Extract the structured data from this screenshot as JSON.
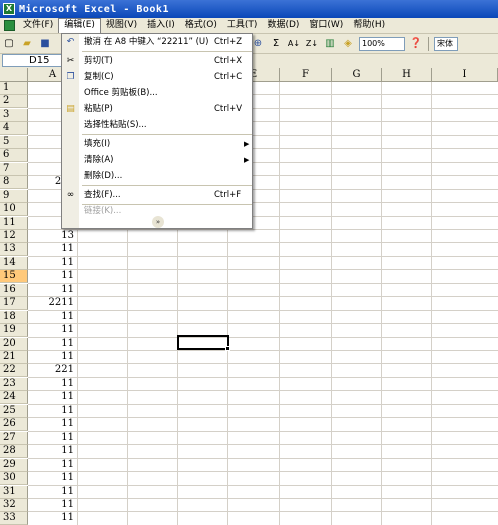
{
  "window": {
    "title": "Microsoft Excel - Book1"
  },
  "menubar": {
    "items": [
      {
        "label": "文件(F)"
      },
      {
        "label": "编辑(E)"
      },
      {
        "label": "视图(V)"
      },
      {
        "label": "插入(I)"
      },
      {
        "label": "格式(O)"
      },
      {
        "label": "工具(T)"
      },
      {
        "label": "数据(D)"
      },
      {
        "label": "窗口(W)"
      },
      {
        "label": "帮助(H)"
      }
    ]
  },
  "toolbar": {
    "zoom": "100%",
    "font": "宋体"
  },
  "formula_bar": {
    "name_box": "D15"
  },
  "edit_menu": {
    "items": [
      {
        "label": "撤消 在 A8 中键入 “22211” (U)",
        "shortcut": "Ctrl+Z",
        "icon": "undo-icon"
      },
      {
        "label": "剪切(T)",
        "shortcut": "Ctrl+X",
        "icon": "scissors-icon"
      },
      {
        "label": "复制(C)",
        "shortcut": "Ctrl+C",
        "icon": "copy-icon"
      },
      {
        "label": "Office 剪贴板(B)...",
        "shortcut": "",
        "icon": "clipboard-icon"
      },
      {
        "label": "粘贴(P)",
        "shortcut": "Ctrl+V",
        "icon": "paste-icon"
      },
      {
        "label": "选择性粘贴(S)...",
        "shortcut": "",
        "icon": ""
      },
      {
        "label": "填充(I)",
        "shortcut": "",
        "icon": ""
      },
      {
        "label": "清除(A)",
        "shortcut": "",
        "icon": ""
      },
      {
        "label": "删除(D)...",
        "shortcut": "",
        "icon": ""
      },
      {
        "label": "查找(F)...",
        "shortcut": "Ctrl+F",
        "icon": "binoculars-icon"
      },
      {
        "label": "链接(K)...",
        "shortcut": "",
        "icon": ""
      }
    ]
  },
  "sheet": {
    "columns": [
      "A",
      "B",
      "C",
      "D",
      "E",
      "F",
      "G",
      "H",
      "I"
    ],
    "rows": [
      "1",
      "2",
      "3",
      "4",
      "5",
      "6",
      "7",
      "8",
      "9",
      "10",
      "11",
      "12",
      "13",
      "14",
      "15",
      "16",
      "17",
      "18",
      "19",
      "20",
      "21",
      "22",
      "23",
      "24",
      "25",
      "26",
      "27",
      "28",
      "29",
      "30",
      "31",
      "32",
      "33"
    ],
    "column_a_values": [
      "",
      "",
      "",
      "",
      "",
      "",
      "",
      "222",
      "",
      "",
      "",
      "13",
      "11",
      "11",
      "11",
      "11",
      "2211",
      "11",
      "11",
      "11",
      "11",
      "221",
      "11",
      "11",
      "11",
      "11",
      "11",
      "11",
      "11",
      "11",
      "11",
      "11",
      "11"
    ],
    "active_cell": "D15"
  }
}
